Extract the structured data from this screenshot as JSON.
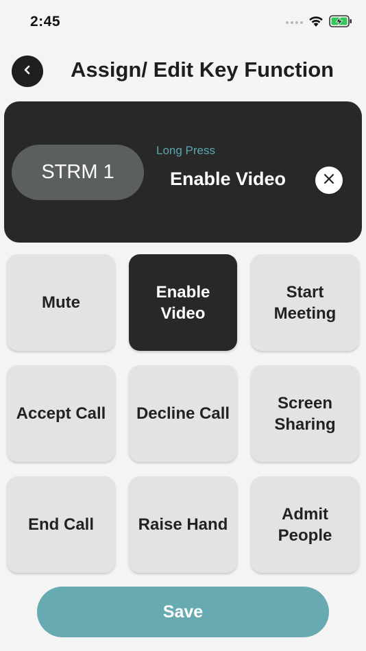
{
  "status_bar": {
    "time": "2:45",
    "icons": [
      "signal-dots-icon",
      "wifi-icon",
      "battery-charging-icon"
    ],
    "battery_color": "#34c759"
  },
  "header": {
    "back_icon": "chevron-left-icon",
    "title": "Assign/ Edit Key Function"
  },
  "selection": {
    "key_label": "STRM 1",
    "press_type": "Long Press",
    "assigned_function": "Enable Video",
    "clear_icon": "close-icon"
  },
  "functions": [
    {
      "label": "Mute",
      "selected": false
    },
    {
      "label": "Enable Video",
      "selected": true
    },
    {
      "label": "Start Meeting",
      "selected": false
    },
    {
      "label": "Accept Call",
      "selected": false
    },
    {
      "label": "Decline Call",
      "selected": false
    },
    {
      "label": "Screen Sharing",
      "selected": false
    },
    {
      "label": "End Call",
      "selected": false
    },
    {
      "label": "Raise Hand",
      "selected": false
    },
    {
      "label": "Admit People",
      "selected": false
    }
  ],
  "save_label": "Save",
  "colors": {
    "accent": "#68aab1",
    "press_type_text": "#5aa9b0",
    "dark_card": "#282828",
    "tile": "#e2e3e4",
    "background": "#f4f4f4"
  }
}
